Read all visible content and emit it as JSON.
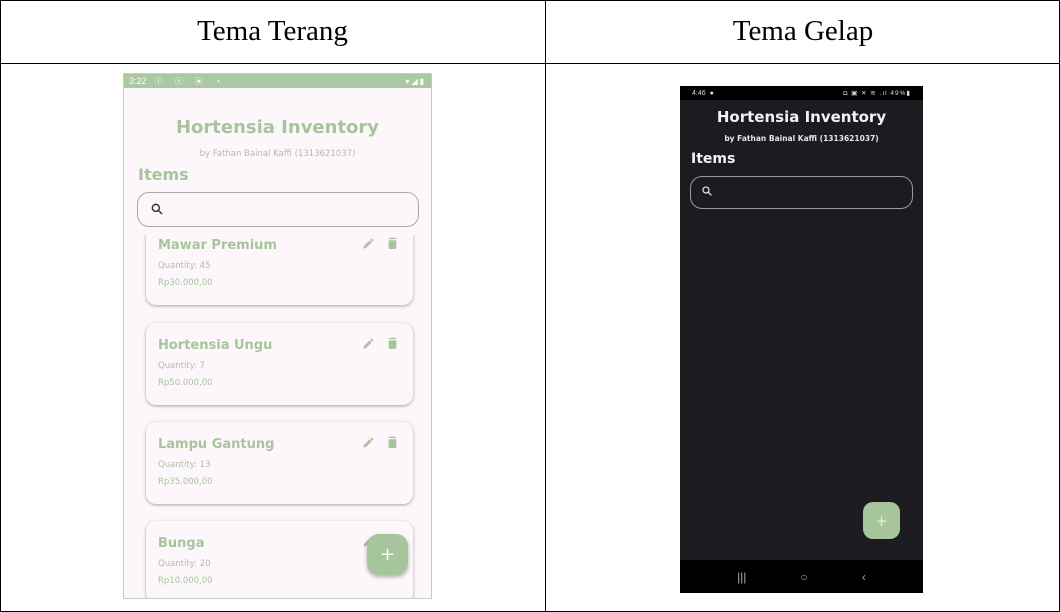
{
  "table": {
    "col_left_header": "Tema Terang",
    "col_right_header": "Tema Gelap"
  },
  "light": {
    "status_time": "3:22",
    "status_left_icons": "ⓘ ⓥ ▣ ◔",
    "status_right_icons": "▾◢▮",
    "title": "Hortensia Inventory",
    "subtitle": "by Fathan Bainal Kaffi (1313621037)",
    "section": "Items",
    "search_icon": "search-icon",
    "items": [
      {
        "name": "Mawar Premium",
        "quantity": "Quantity: 45",
        "price": "Rp30.000,00"
      },
      {
        "name": "Hortensia Ungu",
        "quantity": "Quantity: 7",
        "price": "Rp50.000,00"
      },
      {
        "name": "Lampu Gantung",
        "quantity": "Quantity: 13",
        "price": "Rp35.000,00"
      },
      {
        "name": "Bunga",
        "quantity": "Quantity: 20",
        "price": "Rp10.000,00"
      }
    ],
    "fab_label": "+",
    "accent": "#a6c59c"
  },
  "dark": {
    "status_time": "4:46",
    "status_right": "◘ ▣ ✕ ≋ .ıl 49%▮",
    "title": "Hortensia Inventory",
    "subtitle": "by Fathan Bainal Kaffi (1313621037)",
    "section": "Items",
    "fab_label": "+",
    "nav_recent": "|||",
    "nav_home": "○",
    "nav_back": "‹",
    "background": "#1c1b1f"
  }
}
